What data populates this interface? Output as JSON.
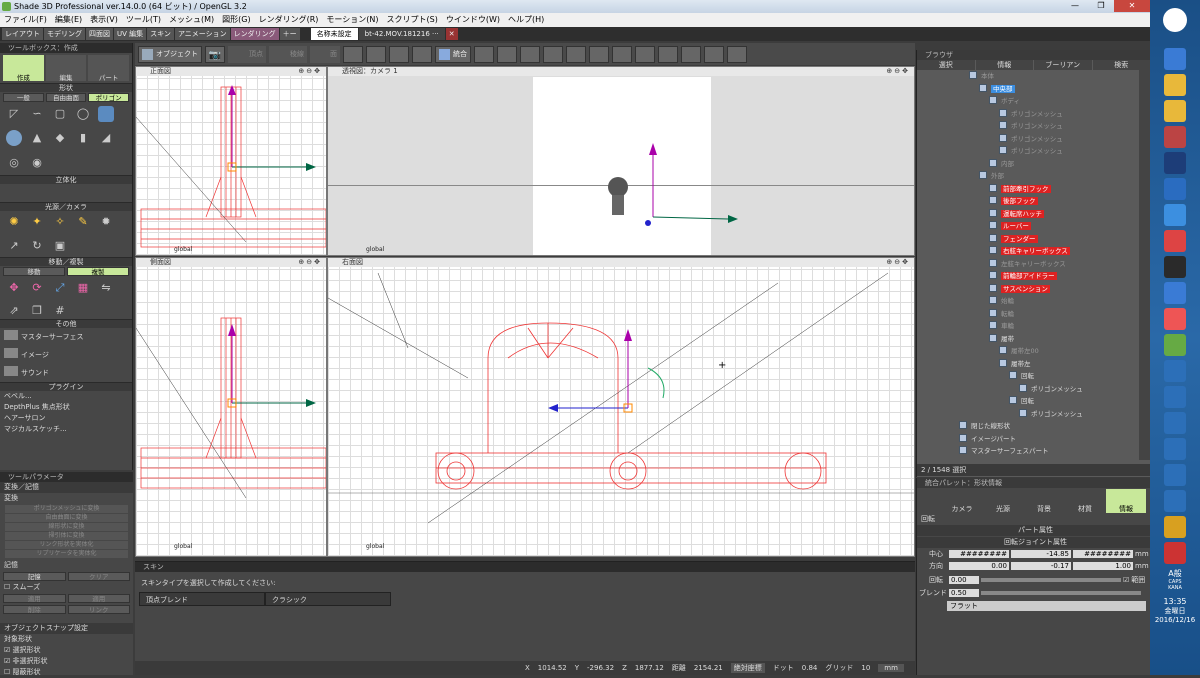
{
  "window": {
    "title": "Shade 3D Professional ver.14.0.0 (64 ビット) / OpenGL 3.2"
  },
  "menu": [
    "ファイル(F)",
    "編集(E)",
    "表示(V)",
    "ツール(T)",
    "メッシュ(M)",
    "図形(G)",
    "レンダリング(R)",
    "モーション(N)",
    "スクリプト(S)",
    "ウインドウ(W)",
    "ヘルプ(H)"
  ],
  "mode_tabs": [
    "レイアウト",
    "モデリング",
    "四面図",
    "UV 編集",
    "スキン",
    "アニメーション",
    "レンダリング",
    "＋ー"
  ],
  "doc_tabs": [
    "名称未設定",
    "bt-42.MOV.181216 ···"
  ],
  "toolbar": {
    "object_label": "オブジェクト",
    "vertex": "頂点",
    "edge": "稜線",
    "face": "面",
    "integrate": "統合"
  },
  "toolbox": {
    "title": "ツールボックス：作成",
    "modes": [
      "作成",
      "編集",
      "パート"
    ],
    "shape_header": "形状",
    "shape_tabs": [
      "一般",
      "自由曲面",
      "ポリゴン"
    ],
    "solid_header": "立体化",
    "light_header": "光源／カメラ",
    "move_header": "移動／複製",
    "move_tabs": [
      "移動",
      "複製"
    ],
    "other_header": "その他",
    "other_items": [
      "マスターサーフェス",
      "イメージ",
      "サウンド"
    ],
    "plugin_header": "プラグイン",
    "plugins": [
      "ベベル...",
      "DepthPlus 焦点形状",
      "ヘアーサロン",
      "マジカルスケッチ..."
    ]
  },
  "toolparams": {
    "title": "ツールパラメータ",
    "section": "変換／記憶",
    "transform_label": "変換",
    "transform_buttons": [
      "ポリゴンメッシュに変換",
      "自由曲面に変換",
      "線形状に変換",
      "掃引体に変換",
      "リンク形状を実体化",
      "リプリケータを実体化"
    ],
    "memory_label": "記憶",
    "memory_btns": [
      "記憶",
      "クリア"
    ],
    "smooth": "スムーズ",
    "apply_btns": [
      "適用",
      "適用",
      "削除",
      "リンク"
    ],
    "snap_title": "オブジェクトスナップ設定",
    "snap_target": "対象形状",
    "snap_opts": [
      "選択形状",
      "非選択形状",
      "隠蔽形状"
    ]
  },
  "viewports": {
    "top_left_label": "正面図",
    "top_right_label": "透視図：カメラ 1",
    "bottom_left_label": "側面図",
    "bottom_right_label": "右面図",
    "global": "global"
  },
  "browser": {
    "title": "ブラウザ",
    "tabs": [
      "選択",
      "情報",
      "ブーリアン",
      "検索"
    ],
    "items": [
      {
        "label": "本体",
        "indent": 4,
        "style": "dim"
      },
      {
        "label": "中央部",
        "indent": 5,
        "style": "blue"
      },
      {
        "label": "ボディ",
        "indent": 6,
        "style": "dim"
      },
      {
        "label": "ポリゴンメッシュ",
        "indent": 7,
        "style": "dim"
      },
      {
        "label": "ポリゴンメッシュ",
        "indent": 7,
        "style": "dim"
      },
      {
        "label": "ポリゴンメッシュ",
        "indent": 7,
        "style": "dim"
      },
      {
        "label": "ポリゴンメッシュ",
        "indent": 7,
        "style": "dim"
      },
      {
        "label": "内部",
        "indent": 6,
        "style": "dim"
      },
      {
        "label": "外部",
        "indent": 5,
        "style": "dim"
      },
      {
        "label": "前部牽引フック",
        "indent": 6,
        "style": "red"
      },
      {
        "label": "後部フック",
        "indent": 6,
        "style": "red"
      },
      {
        "label": "運転席ハッチ",
        "indent": 6,
        "style": "red"
      },
      {
        "label": "ルーバー",
        "indent": 6,
        "style": "red"
      },
      {
        "label": "フェンダー",
        "indent": 6,
        "style": "red"
      },
      {
        "label": "右舷キャリーボックス",
        "indent": 6,
        "style": "red"
      },
      {
        "label": "左舷キャリーボックス",
        "indent": 6,
        "style": "dim"
      },
      {
        "label": "前輪部アイドラー",
        "indent": 6,
        "style": "red"
      },
      {
        "label": "サスペンション",
        "indent": 6,
        "style": "red"
      },
      {
        "label": "始輪",
        "indent": 6,
        "style": "dim"
      },
      {
        "label": "転輪",
        "indent": 6,
        "style": "dim"
      },
      {
        "label": "車輪",
        "indent": 6,
        "style": "dim"
      },
      {
        "label": "履帯",
        "indent": 6,
        "style": "normal"
      },
      {
        "label": "履帯左00",
        "indent": 7,
        "style": "dim"
      },
      {
        "label": "履帯左",
        "indent": 7,
        "style": "normal"
      },
      {
        "label": "回転",
        "indent": 8,
        "style": "normal"
      },
      {
        "label": "ポリゴンメッシュ",
        "indent": 9,
        "style": "normal"
      },
      {
        "label": "回転",
        "indent": 8,
        "style": "normal"
      },
      {
        "label": "ポリゴンメッシュ",
        "indent": 9,
        "style": "normal"
      },
      {
        "label": "閉じた線形状",
        "indent": 3,
        "style": "normal"
      },
      {
        "label": "イメージパート",
        "indent": 3,
        "style": "normal"
      },
      {
        "label": "マスターサーフェスパート",
        "indent": 3,
        "style": "normal"
      }
    ],
    "status": "2 / 1548 選択"
  },
  "palette": {
    "title": "統合パレット：形状情報",
    "tabs": [
      "カメラ",
      "光源",
      "背景",
      "材質",
      "情報"
    ],
    "section": "回転",
    "part_attr": "パート属性",
    "joint_attr": "回転ジョイント属性",
    "rows": [
      {
        "label": "中心",
        "v1": "########",
        "v2": "-14.85",
        "v3": "########",
        "unit": "mm"
      },
      {
        "label": "方向",
        "v1": "0.00",
        "v2": "-0.17",
        "v3": "1.00",
        "unit": "mm"
      }
    ],
    "rotate_label": "回転",
    "rotate_val": "0.00",
    "range_label": "範囲",
    "blend_label": "ブレンド",
    "blend_val": "0.50",
    "flat": "フラット"
  },
  "skin": {
    "title": "スキン",
    "prompt": "スキンタイプを選択して作成してください:",
    "options": [
      "頂点ブレンド",
      "クラシック"
    ]
  },
  "statusbar": {
    "x_label": "X",
    "x": "1014.52",
    "y_label": "Y",
    "y": "-296.32",
    "z_label": "Z",
    "z": "1877.12",
    "dist_label": "距離",
    "dist": "2154.21",
    "mode": "絶対座標",
    "dot_label": "ドット",
    "dot": "0.84",
    "grid_label": "グリッド",
    "grid": "10",
    "unit": "mm"
  },
  "taskbar": {
    "time": "13:35",
    "day": "金曜日",
    "date": "2016/12/16",
    "ime": "A般",
    "caps": "CAPS",
    "kana": "KANA"
  }
}
